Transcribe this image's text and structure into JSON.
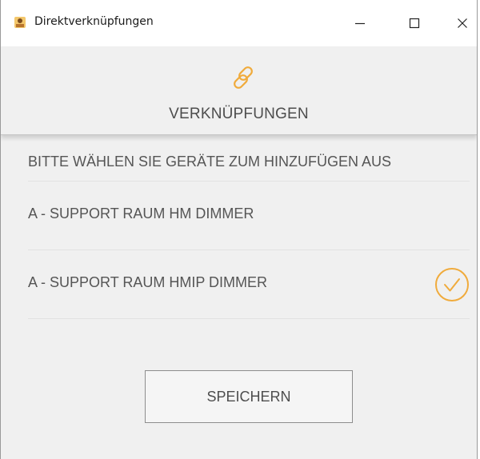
{
  "window": {
    "title": "Direktverknüpfungen",
    "controls": {
      "minimize": "minimize-icon",
      "maximize": "maximize-icon",
      "close": "close-icon"
    }
  },
  "header": {
    "icon": "link-icon",
    "title": "VERKNÜPFUNGEN"
  },
  "main": {
    "instruction": "BITTE WÄHLEN SIE GERÄTE ZUM HINZUFÜGEN AUS",
    "devices": [
      {
        "label": "A - SUPPORT RAUM HM DIMMER",
        "selected": false
      },
      {
        "label": "A - SUPPORT RAUM HMIP DIMMER",
        "selected": true
      }
    ],
    "save_label": "SPEICHERN"
  },
  "colors": {
    "accent": "#f0ab3c",
    "background": "#f0f0f0",
    "text": "#555555",
    "titlebar": "#ffffff"
  }
}
